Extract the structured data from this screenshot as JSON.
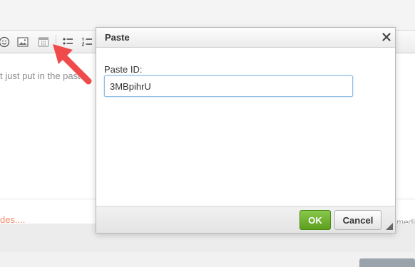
{
  "editor": {
    "content_text": "t just put in the paste",
    "note_link": "des....",
    "status_text": "medi"
  },
  "dialog": {
    "title": "Paste",
    "field_label": "Paste ID:",
    "field_value": "3MBpihrU",
    "ok_label": "OK",
    "cancel_label": "Cancel"
  },
  "colors": {
    "accent_green": "#6ab030",
    "arrow_red": "#f04b4b",
    "input_focus": "#8fbfe6"
  },
  "icons": [
    "smiley-icon",
    "image-icon",
    "calendar-icon",
    "bullet-list-icon",
    "numbered-list-icon",
    "close-icon",
    "resize-grip-icon"
  ]
}
